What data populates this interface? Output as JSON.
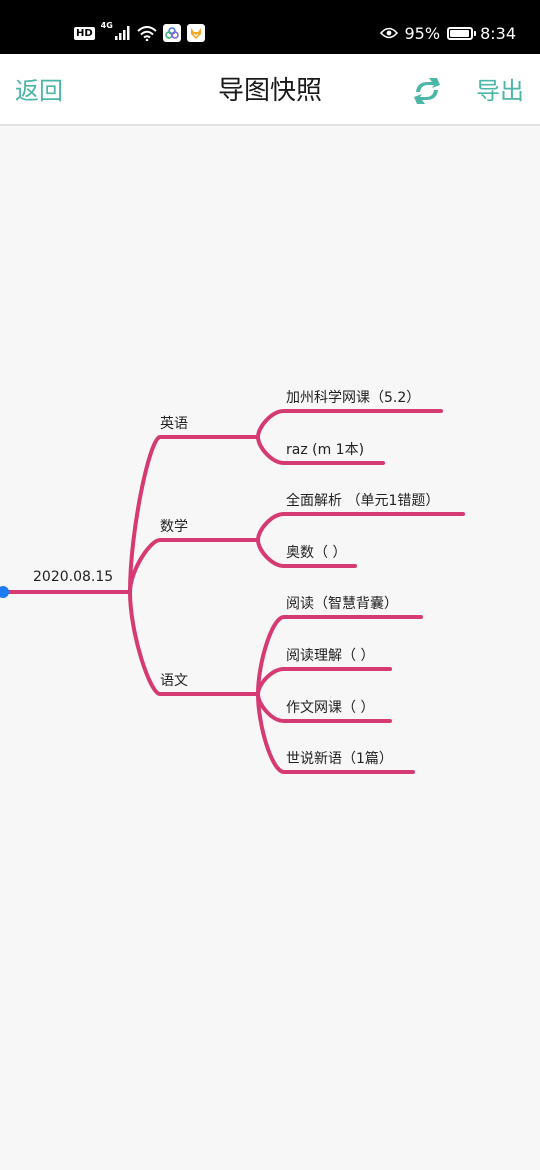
{
  "status_bar": {
    "hd_badge": "HD",
    "network_type": "4G",
    "battery_percent": "95%",
    "battery_level": 0.95,
    "time": "8:34",
    "icons": [
      "signal-icon",
      "wifi-icon",
      "app-notification-icon",
      "fox-app-icon",
      "eye-icon",
      "battery-icon"
    ]
  },
  "app_bar": {
    "back_label": "返回",
    "title": "导图快照",
    "export_label": "导出",
    "refresh_icon": "refresh-icon"
  },
  "colors": {
    "accent": "#4cb6a8",
    "branch": "#d63a72",
    "root_dot": "#1e7cf2",
    "background": "#f7f7f7"
  },
  "mindmap": {
    "root": "2020.08.15",
    "branches": [
      {
        "label": "英语",
        "children": [
          "加州科学网课（5.2）",
          "raz (m 1本)"
        ]
      },
      {
        "label": "数学",
        "children": [
          "全面解析 （单元1错题）",
          "奥数（ ）"
        ]
      },
      {
        "label": "语文",
        "children": [
          "阅读（智慧背囊）",
          "阅读理解（ ）",
          "作文网课（ ）",
          "世说新语（1篇）"
        ]
      }
    ]
  }
}
